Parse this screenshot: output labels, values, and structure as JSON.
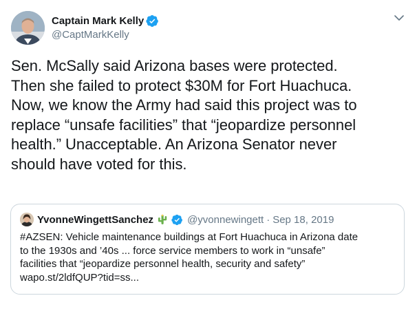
{
  "tweet": {
    "author": {
      "display_name": "Captain Mark Kelly",
      "handle": "@CaptMarkKelly",
      "verified": true
    },
    "text": "Sen. McSally said Arizona bases were protected.\nThen she failed to protect $30M for Fort Huachuca.\nNow, we know the Army had said this project was to\nreplace “unsafe facilities” that “jeopardize personnel\nhealth.” Unacceptable. An Arizona Senator never\nshould have voted for this.",
    "menu_icon": "chevron-down-icon"
  },
  "quoted_tweet": {
    "author": {
      "display_name": "YvonneWingettSanchez",
      "emoji": "🌵",
      "verified": true,
      "handle": "@yvonnewingett"
    },
    "separator": "·",
    "date": "Sep 18, 2019",
    "text": "#AZSEN: Vehicle maintenance buildings at Fort Huachuca in Arizona date\nto the 1930s and ’40s ... force service members to work in “unsafe”\nfacilities that “jeopardize personnel health, security and safety”\nwapo.st/2ldfQUP?tid=ss..."
  },
  "colors": {
    "text": "#14171a",
    "secondary": "#657786",
    "verified_blue": "#1da1f2",
    "border": "#ccd6dd"
  }
}
